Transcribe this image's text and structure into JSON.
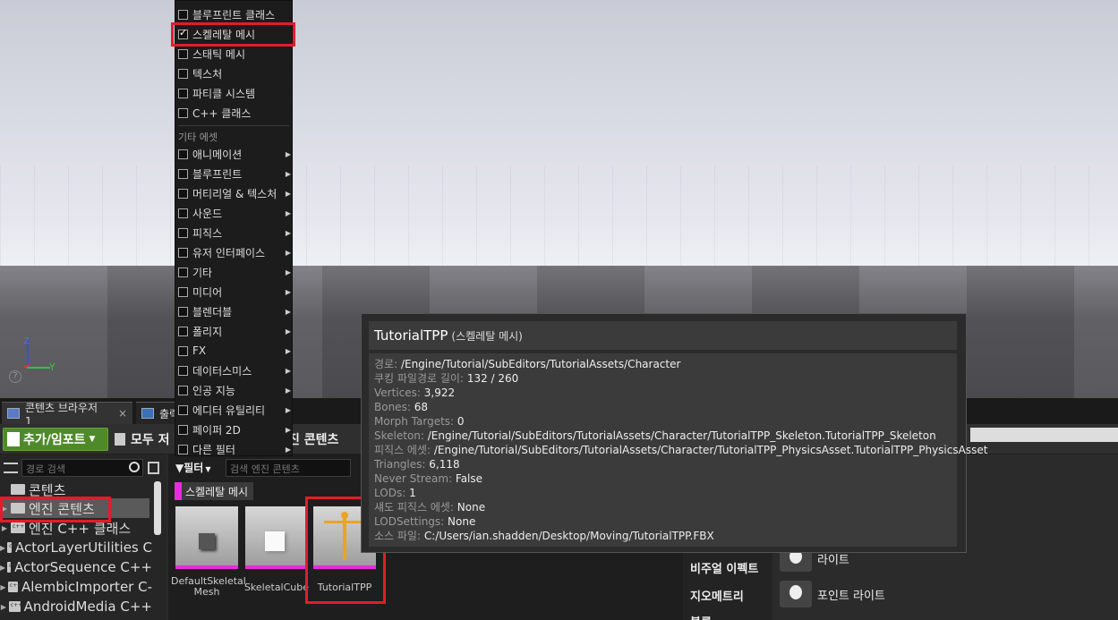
{
  "viewport": {
    "axis_y": "Y",
    "axis_z": "Z",
    "help": "?"
  },
  "tabs": [
    {
      "label": "콘텐츠 브라우저 1",
      "close": "×"
    },
    {
      "label": "출력"
    }
  ],
  "toolbar": {
    "add_import": "추가/임포트",
    "save_all": "모두 저",
    "path": "진 콘텐츠"
  },
  "sources": {
    "search_placeholder": "경로 검색",
    "items": [
      {
        "label": "콘텐츠"
      },
      {
        "label": "엔진 콘텐츠"
      },
      {
        "label": "엔진 C++ 클래스"
      },
      {
        "label": "ActorLayerUtilities C"
      },
      {
        "label": "ActorSequence C++"
      },
      {
        "label": "AlembicImporter C-"
      },
      {
        "label": "AndroidMedia C++"
      }
    ]
  },
  "assets": {
    "filter_label": "필터",
    "search_placeholder": "검색 엔진 콘텐츠",
    "filter_chip": "스켈레탈 메시",
    "accent_color": "#e52ddc",
    "tiles": [
      {
        "line1": "DefaultSkeletal",
        "line2": "Mesh"
      },
      {
        "line1": "SkeletalCube",
        "line2": ""
      },
      {
        "line1": "TutorialTPP",
        "line2": ""
      }
    ]
  },
  "details": {
    "categories": [
      "비주얼 이펙트",
      "지오메트리",
      "볼류"
    ],
    "items": [
      "라이트",
      "포인트 라이트"
    ]
  },
  "menu": {
    "top_items": [
      {
        "label": "블루프린트 클래스",
        "checked": false
      },
      {
        "label": "스켈레탈 메시",
        "checked": true
      },
      {
        "label": "스태틱 메시",
        "checked": false
      },
      {
        "label": "텍스처",
        "checked": false
      },
      {
        "label": "파티클 시스템",
        "checked": false
      },
      {
        "label": "C++ 클래스",
        "checked": false
      }
    ],
    "section_label": "기타 에셋",
    "other_items": [
      {
        "label": "애니메이션"
      },
      {
        "label": "블루프린트"
      },
      {
        "label": "머티리얼 & 텍스처"
      },
      {
        "label": "사운드"
      },
      {
        "label": "피직스"
      },
      {
        "label": "유저 인터페이스"
      },
      {
        "label": "기타"
      },
      {
        "label": "미디어"
      },
      {
        "label": "블렌더블"
      },
      {
        "label": "폴리지"
      },
      {
        "label": "FX"
      },
      {
        "label": "데이터스미스"
      },
      {
        "label": "인공 지능"
      },
      {
        "label": "에디터 유틸리티"
      },
      {
        "label": "페이퍼 2D"
      },
      {
        "label": "다른 필터"
      }
    ]
  },
  "tooltip": {
    "name": "TutorialTPP",
    "type": "(스켈레탈 메시)",
    "rows": [
      {
        "k": "경로:",
        "v": "/Engine/Tutorial/SubEditors/TutorialAssets/Character"
      },
      {
        "k": "쿠킹 파일경로 길이:",
        "v": "132 / 260"
      },
      {
        "k": "Vertices:",
        "v": "3,922"
      },
      {
        "k": "Bones:",
        "v": "68"
      },
      {
        "k": "Morph Targets:",
        "v": "0"
      },
      {
        "k": "Skeleton:",
        "v": "/Engine/Tutorial/SubEditors/TutorialAssets/Character/TutorialTPP_Skeleton.TutorialTPP_Skeleton"
      },
      {
        "k": "피직스 에셋:",
        "v": "/Engine/Tutorial/SubEditors/TutorialAssets/Character/TutorialTPP_PhysicsAsset.TutorialTPP_PhysicsAsset"
      },
      {
        "k": "Triangles:",
        "v": "6,118"
      },
      {
        "k": "Never Stream:",
        "v": "False"
      },
      {
        "k": "LODs:",
        "v": "1"
      },
      {
        "k": "섀도 피직스 에셋:",
        "v": "None"
      },
      {
        "k": "LODSettings:",
        "v": "None"
      },
      {
        "k": "소스 파일:",
        "v": "C:/Users/ian.shadden/Desktop/Moving/TutorialTPP.FBX"
      }
    ]
  },
  "highlight_color": "#e11d2a"
}
